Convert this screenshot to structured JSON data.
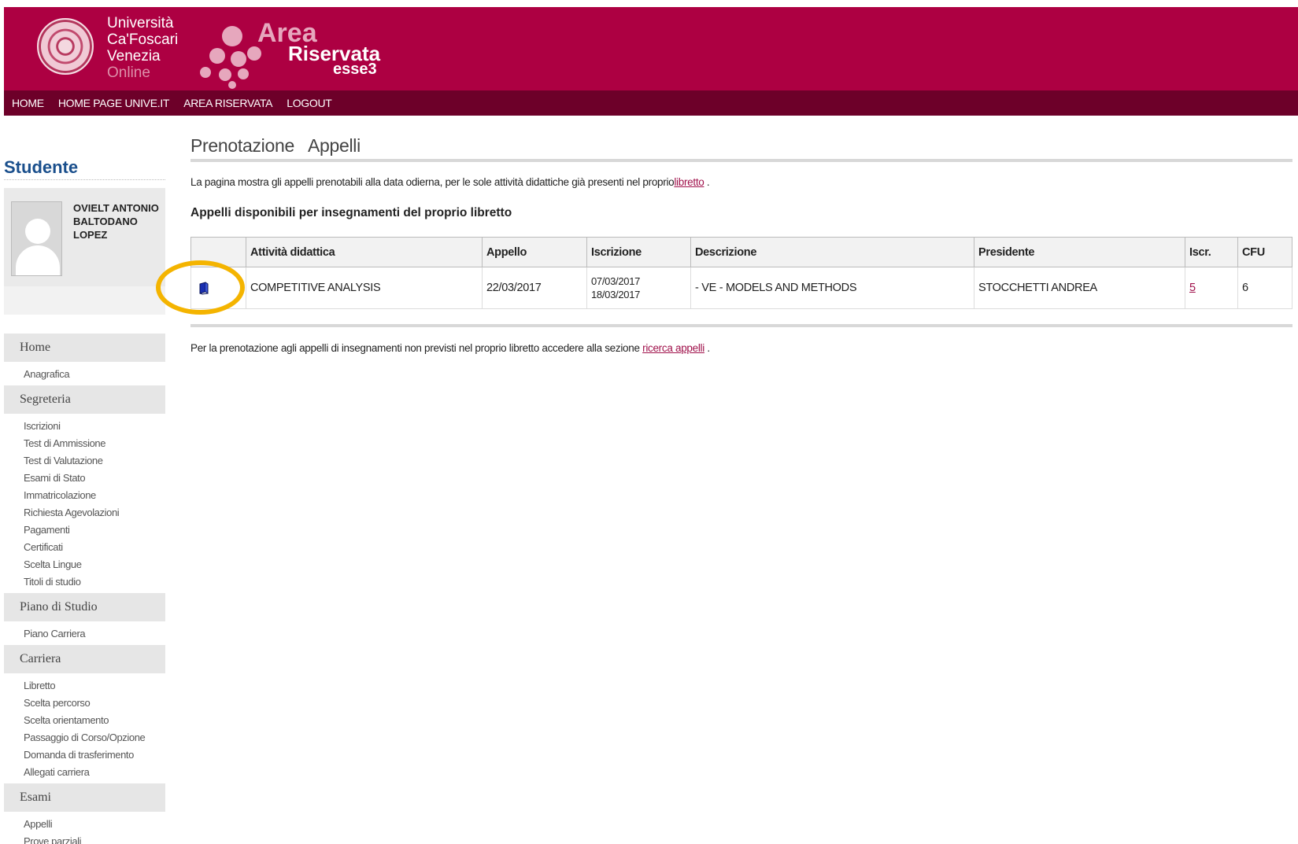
{
  "header": {
    "university_lines": [
      "Università",
      "Ca'Foscari",
      "Venezia",
      "Online"
    ],
    "area_logo": {
      "area": "Area",
      "riservata": "Riservata",
      "esse3": "esse3"
    }
  },
  "nav": {
    "items": [
      "HOME",
      "HOME PAGE UNIVE.IT",
      "AREA RISERVATA",
      "LOGOUT"
    ]
  },
  "sidebar": {
    "title": "Studente",
    "student_name_lines": [
      "OVIELT ANTONIO",
      "BALTODANO",
      "LOPEZ"
    ],
    "menu": [
      {
        "section": "Home",
        "items": [
          "Anagrafica"
        ]
      },
      {
        "section": "Segreteria",
        "items": [
          "Iscrizioni",
          "Test di Ammissione",
          "Test di Valutazione",
          "Esami di Stato",
          "Immatricolazione",
          "Richiesta Agevolazioni",
          "Pagamenti",
          "Certificati",
          "Scelta Lingue",
          "Titoli di studio"
        ]
      },
      {
        "section": "Piano di Studio",
        "items": [
          "Piano Carriera"
        ]
      },
      {
        "section": "Carriera",
        "items": [
          "Libretto",
          "Scelta percorso",
          "Scelta orientamento",
          "Passaggio di Corso/Opzione",
          "Domanda di trasferimento",
          "Allegati carriera"
        ]
      },
      {
        "section": "Esami",
        "items": [
          "Appelli",
          "Prove parziali"
        ]
      }
    ]
  },
  "main": {
    "title": "Prenotazione   Appelli",
    "intro_text": "La pagina mostra gli appelli prenotabili alla data odierna, per le sole attività didattiche già presenti nel proprio",
    "intro_link": "libretto",
    "intro_end": " .",
    "section_title": "Appelli disponibili per insegnamenti del proprio libretto",
    "table": {
      "headers": [
        "",
        "Attività didattica",
        "Appello",
        "Iscrizione",
        "Descrizione",
        "Presidente",
        "Iscr.",
        "CFU"
      ],
      "row": {
        "attivita": "COMPETITIVE ANALYSIS",
        "appello": "22/03/2017",
        "iscrizione_start": "07/03/2017",
        "iscrizione_end": "18/03/2017",
        "descrizione": "- VE - MODELS AND METHODS",
        "presidente": "STOCCHETTI ANDREA",
        "iscr": "5",
        "cfu": "6"
      }
    },
    "footnote_text": "Per la prenotazione agli appelli di insegnamenti non previsti nel proprio libretto accedere alla sezione ",
    "footnote_link": "ricerca appelli",
    "footnote_end": " ."
  },
  "colors": {
    "header_bg": "#ad0042",
    "nav_bg": "#6d0029",
    "link": "#a0114b",
    "student_title": "#1a4f8c",
    "highlight": "#f4b400"
  },
  "icons": {
    "book": "book-icon",
    "avatar": "user-avatar-icon"
  }
}
